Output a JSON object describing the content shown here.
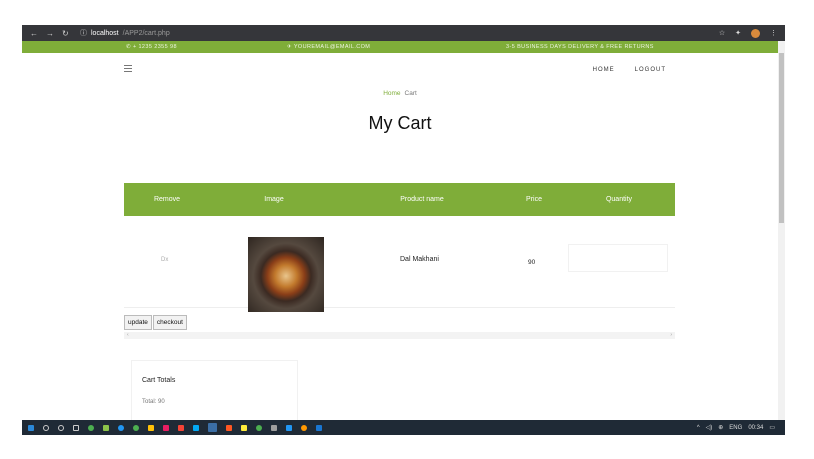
{
  "browser": {
    "url_host": "localhost",
    "url_path": "/APP2/cart.php"
  },
  "topbar": {
    "phone": "+ 1235 2355 98",
    "email": "YOUREMAIL@EMAIL.COM",
    "shipping": "3-5 BUSINESS DAYS DELIVERY & FREE RETURNS"
  },
  "nav": {
    "home": "HOME",
    "logout": "LOGOUT"
  },
  "breadcrumb": {
    "home": "Home",
    "current": "Cart"
  },
  "page_title": "My Cart",
  "table": {
    "headers": [
      "Remove",
      "Image",
      "Product name",
      "Price",
      "Quantity"
    ],
    "rows": [
      {
        "remove": "Dx",
        "product_name": "Dal Makhani",
        "price": "90"
      }
    ]
  },
  "buttons": {
    "update": "update",
    "checkout": "checkout"
  },
  "cart_totals": {
    "heading": "Cart Totals",
    "total": "Total: 90"
  },
  "taskbar": {
    "lang": "ENG",
    "time": "00:34"
  },
  "colors": {
    "accent": "#7fad39",
    "chrome": "#35363a",
    "taskbar": "#1f2a36"
  }
}
